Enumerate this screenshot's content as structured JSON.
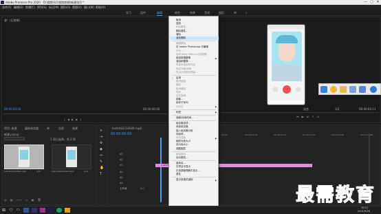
{
  "app": {
    "title": "Adobe Premiere Pro 2020 - D:\\视频\\SCI\\视频剪辑\\新建项目 *",
    "window_controls": [
      "—",
      "▢",
      "✕"
    ]
  },
  "menubar": [
    "文件(F)",
    "编辑(E)",
    "剪辑(C)",
    "序列(S)",
    "标记(M)",
    "图形(G)",
    "视图(V)",
    "窗口(W)",
    "帮助(H)"
  ],
  "workspaces": {
    "items": [
      "学习",
      "组件",
      "编辑",
      "颜色",
      "效果",
      "音频",
      "图形",
      "库"
    ],
    "active_index": 2,
    "more": "»"
  },
  "source_panel": {
    "title": "源：(无剪辑)",
    "timecode_left": "00;00;00;00",
    "timecode_right": "00;00;00;00"
  },
  "program_panel": {
    "timecode_left": "00:00:00:00",
    "fit": "适合",
    "fraction": "1/2",
    "timecode_right": "00:00:04:11"
  },
  "project_panel": {
    "tabs": [
      "项目: 新建",
      "媒体浏览器",
      "库",
      "信息",
      "效果"
    ],
    "path": "新建.prproj",
    "count": "1 项已选择，共 2 项",
    "items": [
      {
        "name": "Inshot20210926.mp4",
        "duration": "4:11"
      },
      {
        "name": "Inshot20210926.mp4",
        "duration": "4:11"
      }
    ]
  },
  "timeline": {
    "tab": "Inshot20210926.mp4",
    "timecode": "00:00:00:00",
    "ruler": [
      "00:00",
      "00:00:01:00",
      "00:00:02:00",
      "00:00:03:00",
      "00:00:04:00",
      "00:00:05:00"
    ],
    "tracks": [
      "V3",
      "V2",
      "V1",
      "A1",
      "A2",
      "A3"
    ],
    "master": "主声道",
    "master_value": "0.0",
    "video_clip": "fx",
    "audio_clip": "Inshot20210926.mp4 [A]"
  },
  "context_menu": {
    "items": [
      {
        "label": "取消",
        "state": "normal"
      },
      {
        "label": "复制",
        "state": "normal"
      },
      {
        "label": "粘贴属性...",
        "state": "disabled"
      },
      {
        "label": "删除属性...",
        "state": "normal"
      },
      {
        "label": "清除",
        "state": "normal"
      },
      {
        "label": "波纹删除",
        "state": "highlighted"
      },
      {
        "label": "---",
        "state": "sep"
      },
      {
        "label": "编辑原始",
        "state": "disabled"
      },
      {
        "label": "在 Adobe Photoshop 中编辑",
        "state": "normal"
      },
      {
        "label": "许可...",
        "state": "disabled"
      },
      {
        "label": "使用 After Effects 合成替换",
        "state": "disabled"
      },
      {
        "label": "使用剪辑替换",
        "state": "normal",
        "submenu": true
      },
      {
        "label": "渲染和替换...",
        "state": "normal"
      },
      {
        "label": "恢复未渲染的内容",
        "state": "disabled"
      },
      {
        "label": "恢复字幕/转换",
        "state": "disabled"
      },
      {
        "label": "导出动态图形模板...",
        "state": "disabled"
      },
      {
        "label": "---",
        "state": "sep"
      },
      {
        "label": "启用",
        "state": "checked"
      },
      {
        "label": "取消链接",
        "state": "disabled"
      },
      {
        "label": "编组",
        "state": "disabled"
      },
      {
        "label": "取消编组",
        "state": "disabled"
      },
      {
        "label": "同步",
        "state": "disabled"
      },
      {
        "label": "合并剪辑...",
        "state": "disabled"
      },
      {
        "label": "嵌套...",
        "state": "normal"
      },
      {
        "label": "制作子序列",
        "state": "normal"
      },
      {
        "label": "多机位",
        "state": "disabled",
        "submenu": true
      },
      {
        "label": "---",
        "state": "sep"
      },
      {
        "label": "标签",
        "state": "normal",
        "submenu": true
      },
      {
        "label": "---",
        "state": "sep"
      },
      {
        "label": "速度/持续时间...",
        "state": "normal"
      },
      {
        "label": "---",
        "state": "sep"
      },
      {
        "label": "帧定格选项...",
        "state": "normal"
      },
      {
        "label": "添加帧定格",
        "state": "normal"
      },
      {
        "label": "插入帧定格分段",
        "state": "normal"
      },
      {
        "label": "场选项...",
        "state": "normal"
      },
      {
        "label": "时间插值",
        "state": "disabled",
        "submenu": true
      },
      {
        "label": "缩放为帧大小",
        "state": "normal"
      },
      {
        "label": "设为帧大小",
        "state": "normal"
      },
      {
        "label": "调整图层",
        "state": "normal"
      },
      {
        "label": "---",
        "state": "sep"
      },
      {
        "label": "链接媒体...",
        "state": "disabled"
      },
      {
        "label": "设为脱机...",
        "state": "normal"
      },
      {
        "label": "---",
        "state": "sep"
      },
      {
        "label": "重命名...",
        "state": "normal"
      },
      {
        "label": "在项目中显示",
        "state": "normal"
      },
      {
        "label": "在资源管理器中显示...",
        "state": "normal"
      },
      {
        "label": "属性",
        "state": "normal"
      },
      {
        "label": "---",
        "state": "sep"
      },
      {
        "label": "显示剪辑关键帧",
        "state": "normal",
        "submenu": true
      }
    ]
  },
  "floating_toolbar": {
    "tools": [
      "selection-tool",
      "chat-tool",
      "folder-tool",
      "camera-tool",
      "grid-tool",
      "help-tool"
    ]
  },
  "taskbar": {
    "time": "10:12",
    "date": "2021/9/26"
  },
  "watermark": {
    "text": "最需教育"
  },
  "colors": {
    "accent": "#4b9cf5",
    "clip_video": "#c277c4",
    "clip_audio": "#e08fe0",
    "watermark": "#1f3ebf"
  }
}
